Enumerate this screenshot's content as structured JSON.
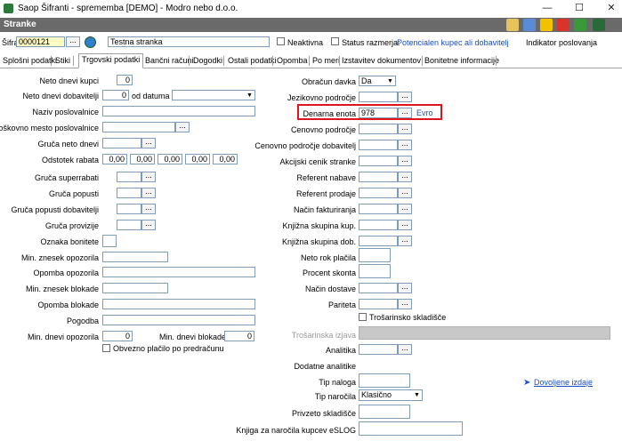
{
  "window": {
    "title": "Saop Šifranti - sprememba [DEMO] - Modro nebo d.o.o.",
    "section_title": "Stranke"
  },
  "header": {
    "sifra_label": "Šifra",
    "sifra_value": "0000121",
    "name_value": "Testna stranka",
    "neaktivna_label": "Neaktivna",
    "status_label": "Status razmerja:",
    "status_value": "Potencialen kupec ali dobavitelj",
    "indicator_label": "Indikator poslovanja"
  },
  "tabs": [
    "Splošni podatki",
    "Stiki",
    "Trgovski podatki",
    "Bančni računi",
    "Dogodki",
    "Ostali podatki",
    "Opomba",
    "Po meri",
    "Izstavitev dokumentov",
    "Bonitetne informacije"
  ],
  "left": {
    "neto_dnevi_kupci": {
      "label": "Neto dnevi kupci",
      "value": "0"
    },
    "neto_dnevi_dob": {
      "label": "Neto dnevi dobavitelji",
      "value": "0"
    },
    "od_datuma": {
      "label": "od datuma",
      "value": ""
    },
    "naziv": {
      "label": "Naziv poslovalnice",
      "value": ""
    },
    "strosk": {
      "label": "Stroškovno mesto poslovalnice",
      "value": ""
    },
    "gruca_neto": {
      "label": "Gruča neto dnevi",
      "value": ""
    },
    "odstotek": {
      "label": "Odstotek rabata",
      "values": [
        "0,00",
        "0,00",
        "0,00",
        "0,00",
        "0,00"
      ]
    },
    "gruca_sup": {
      "label": "Gruča superrabati"
    },
    "gruca_pop": {
      "label": "Gruča popusti"
    },
    "gruca_pop_dob": {
      "label": "Gruča popusti dobavitelji"
    },
    "gruca_prov": {
      "label": "Gruča provizije"
    },
    "oznaka": {
      "label": "Oznaka bonitete"
    },
    "min_opo": {
      "label": "Min. znesek opozorila"
    },
    "opomba_opo": {
      "label": "Opomba opozorila"
    },
    "min_blok": {
      "label": "Min. znesek blokade"
    },
    "opomba_blok": {
      "label": "Opomba blokade"
    },
    "pogodba": {
      "label": "Pogodba"
    },
    "min_dnevi_opo": {
      "label": "Min. dnevi opozorila",
      "value": "0"
    },
    "min_dnevi_blok": {
      "label": "Min. dnevi blokade",
      "value": "0"
    },
    "obvezno": {
      "label": "Obvezno plačilo po predračunu"
    }
  },
  "right": {
    "obracun": {
      "label": "Obračun davka",
      "value": "Da"
    },
    "jezikovno": {
      "label": "Jezikovno področje"
    },
    "denarna": {
      "label": "Denarna enota",
      "value": "978",
      "currency": "Evro"
    },
    "cenovno": {
      "label": "Cenovno področje"
    },
    "cenovno_dob": {
      "label": "Cenovno področje dobavitelj"
    },
    "akcijski": {
      "label": "Akcijski cenik stranke"
    },
    "ref_nabave": {
      "label": "Referent nabave"
    },
    "ref_prodaje": {
      "label": "Referent prodaje"
    },
    "nacin_fakt": {
      "label": "Način fakturiranja"
    },
    "knjizna_kup": {
      "label": "Knjižna skupina kup."
    },
    "knjizna_dob": {
      "label": "Knjižna skupina dob."
    },
    "neto_rok": {
      "label": "Neto rok plačila"
    },
    "procent": {
      "label": "Procent skonta"
    },
    "nacin_dost": {
      "label": "Način dostave"
    },
    "pariteta": {
      "label": "Pariteta"
    },
    "trosarinsko_chk": {
      "label": "Trošarinsko skladišče"
    },
    "trosarinska_izjava": {
      "label": "Trošarinska izjava"
    },
    "analitika": {
      "label": "Analitika"
    },
    "dodatne": {
      "label": "Dodatne analitike"
    },
    "tip_naloga": {
      "label": "Tip naloga"
    },
    "tip_narocila": {
      "label": "Tip naročila",
      "value": "Klasično"
    },
    "privzeto": {
      "label": "Privzeto skladišče"
    },
    "knjiga": {
      "label": "Knjiga za naročila kupcev eSLOG"
    },
    "dovoljene": {
      "label": "Dovoljene izdaje"
    }
  },
  "buttons": {
    "browse": "..."
  },
  "colors": {
    "band": "#6a6a6a",
    "highlight": "#e0141e",
    "link": "#1a4fc4",
    "sifra_bg": "#fff9c4"
  }
}
